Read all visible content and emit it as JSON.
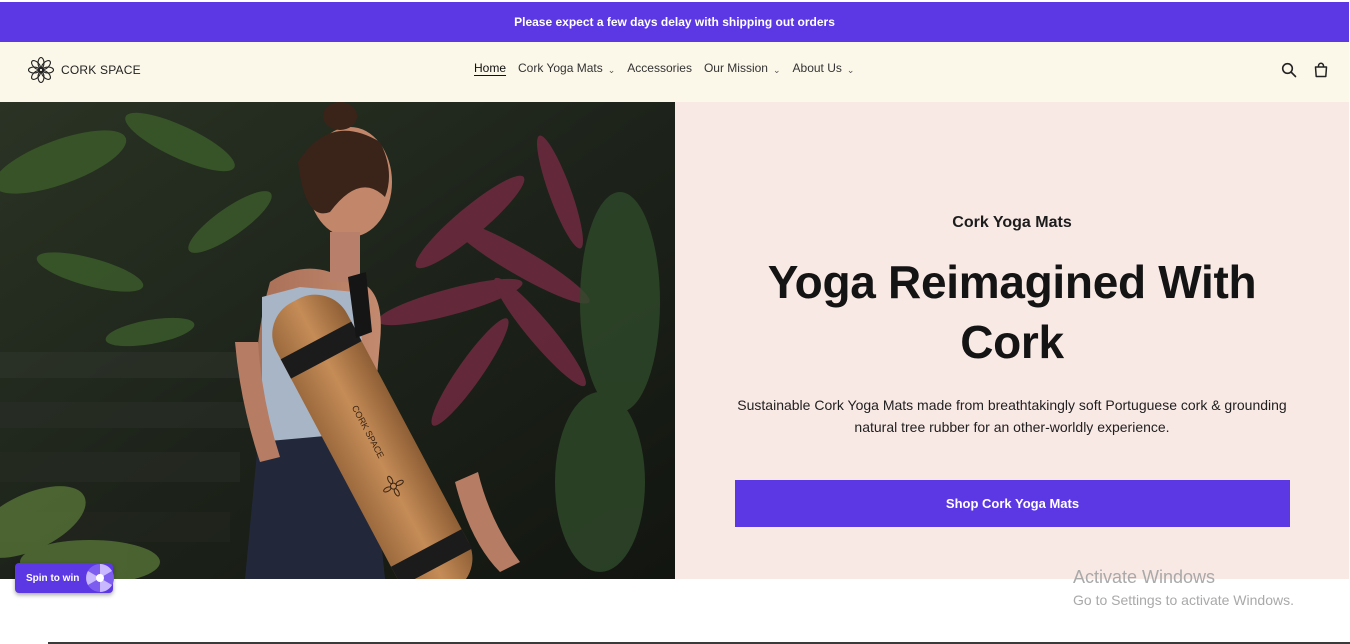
{
  "announcement": "Please expect a few days delay with shipping out orders",
  "brand": {
    "name": "CORK SPACE",
    "icon": "lotus-logo-icon"
  },
  "nav": {
    "items": [
      {
        "label": "Home",
        "active": true,
        "has_dropdown": false
      },
      {
        "label": "Cork Yoga Mats",
        "active": false,
        "has_dropdown": true
      },
      {
        "label": "Accessories",
        "active": false,
        "has_dropdown": false
      },
      {
        "label": "Our Mission",
        "active": false,
        "has_dropdown": true
      },
      {
        "label": "About Us",
        "active": false,
        "has_dropdown": true
      }
    ]
  },
  "header_icons": [
    "search-icon",
    "cart-icon"
  ],
  "hero": {
    "image": "woman-carrying-cork-yoga-mat-photo",
    "eyebrow": "Cork Yoga Mats",
    "headline": "Yoga Reimagined With Cork",
    "subtext": "Sustainable Cork Yoga Mats made from breathtakingly soft Portuguese cork & grounding natural tree rubber for an other-worldly experience.",
    "cta_label": "Shop Cork Yoga Mats"
  },
  "spin_widget": {
    "label": "Spin to win"
  },
  "watermark": {
    "title": "Activate Windows",
    "subtitle": "Go to Settings to activate Windows."
  },
  "colors": {
    "accent": "#5b38e3",
    "header_bg": "#fbf8e9",
    "hero_panel_bg": "#f9e9e5"
  }
}
